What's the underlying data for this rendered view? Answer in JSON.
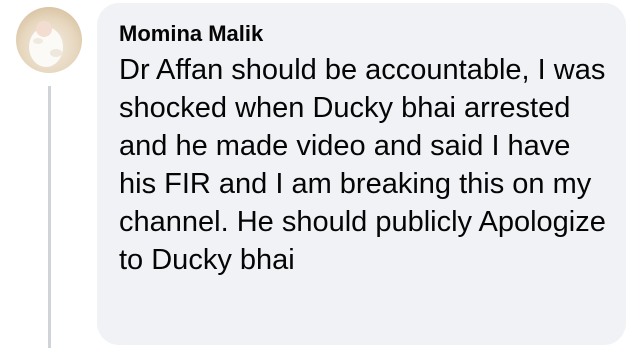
{
  "comment": {
    "author_name": "Momina Malik",
    "text": "Dr Affan should be accountable, I was shocked when Ducky bhai arrested and he made video and said I have his FIR and I am breaking this on my channel. He should publicly Apologize to Ducky bhai",
    "avatar_icon": "profile-photo-avatar"
  },
  "colors": {
    "bubble_background": "#f0f2f5",
    "text": "#050505",
    "thread_line": "#d0d3d7"
  }
}
